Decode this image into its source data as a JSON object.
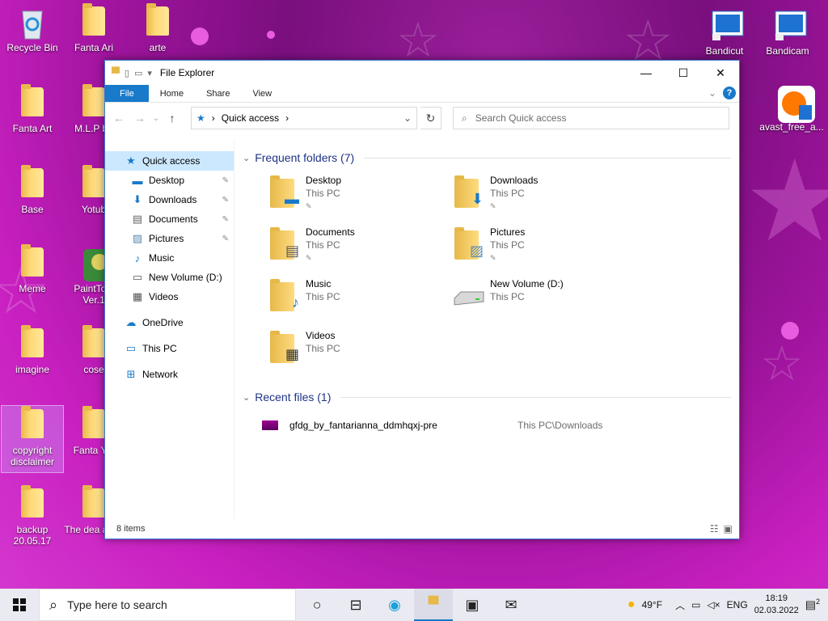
{
  "desktop": {
    "icons": [
      {
        "label": "Recycle Bin"
      },
      {
        "label": "Fanta Ari"
      },
      {
        "label": "arte"
      },
      {
        "label": "Bandicut"
      },
      {
        "label": "Bandicam"
      },
      {
        "label": "Fanta Art"
      },
      {
        "label": "M.L.P ba"
      },
      {
        "label": "avast_free_a..."
      },
      {
        "label": "Base"
      },
      {
        "label": "Yotub"
      },
      {
        "label": "Meme"
      },
      {
        "label": "PaintTool Ver.1"
      },
      {
        "label": "imagine"
      },
      {
        "label": "cose"
      },
      {
        "label": "copyright disclaimer"
      },
      {
        "label": "Fanta Yot"
      },
      {
        "label": "backup 20.05.17"
      },
      {
        "label": "The dea artist"
      }
    ]
  },
  "window": {
    "title": "File Explorer",
    "ribbon_tabs": [
      "File",
      "Home",
      "Share",
      "View"
    ],
    "address": "Quick access",
    "search_placeholder": "Search Quick access",
    "status": "8 items"
  },
  "nav": {
    "items": [
      {
        "label": "Quick access"
      },
      {
        "label": "Desktop"
      },
      {
        "label": "Downloads"
      },
      {
        "label": "Documents"
      },
      {
        "label": "Pictures"
      },
      {
        "label": "Music"
      },
      {
        "label": "New Volume (D:)"
      },
      {
        "label": "Videos"
      },
      {
        "label": "OneDrive"
      },
      {
        "label": "This PC"
      },
      {
        "label": "Network"
      }
    ]
  },
  "content": {
    "frequent_header": "Frequent folders (7)",
    "recent_header": "Recent files (1)",
    "folders": [
      {
        "name": "Desktop",
        "location": "This PC"
      },
      {
        "name": "Downloads",
        "location": "This PC"
      },
      {
        "name": "Documents",
        "location": "This PC"
      },
      {
        "name": "Pictures",
        "location": "This PC"
      },
      {
        "name": "Music",
        "location": "This PC"
      },
      {
        "name": "New Volume (D:)",
        "location": "This PC"
      },
      {
        "name": "Videos",
        "location": "This PC"
      }
    ],
    "recent": [
      {
        "name": "gfdg_by_fantarianna_ddmhqxj-pre",
        "path": "This PC\\Downloads"
      }
    ]
  },
  "taskbar": {
    "search_placeholder": "Type here to search",
    "weather": "49°F",
    "lang": "ENG",
    "time": "18:19",
    "date": "02.03.2022",
    "notif_count": "2"
  },
  "colors": {
    "accent": "#1979ca",
    "selection": "#cce8ff",
    "header_blue": "#1e3287"
  }
}
